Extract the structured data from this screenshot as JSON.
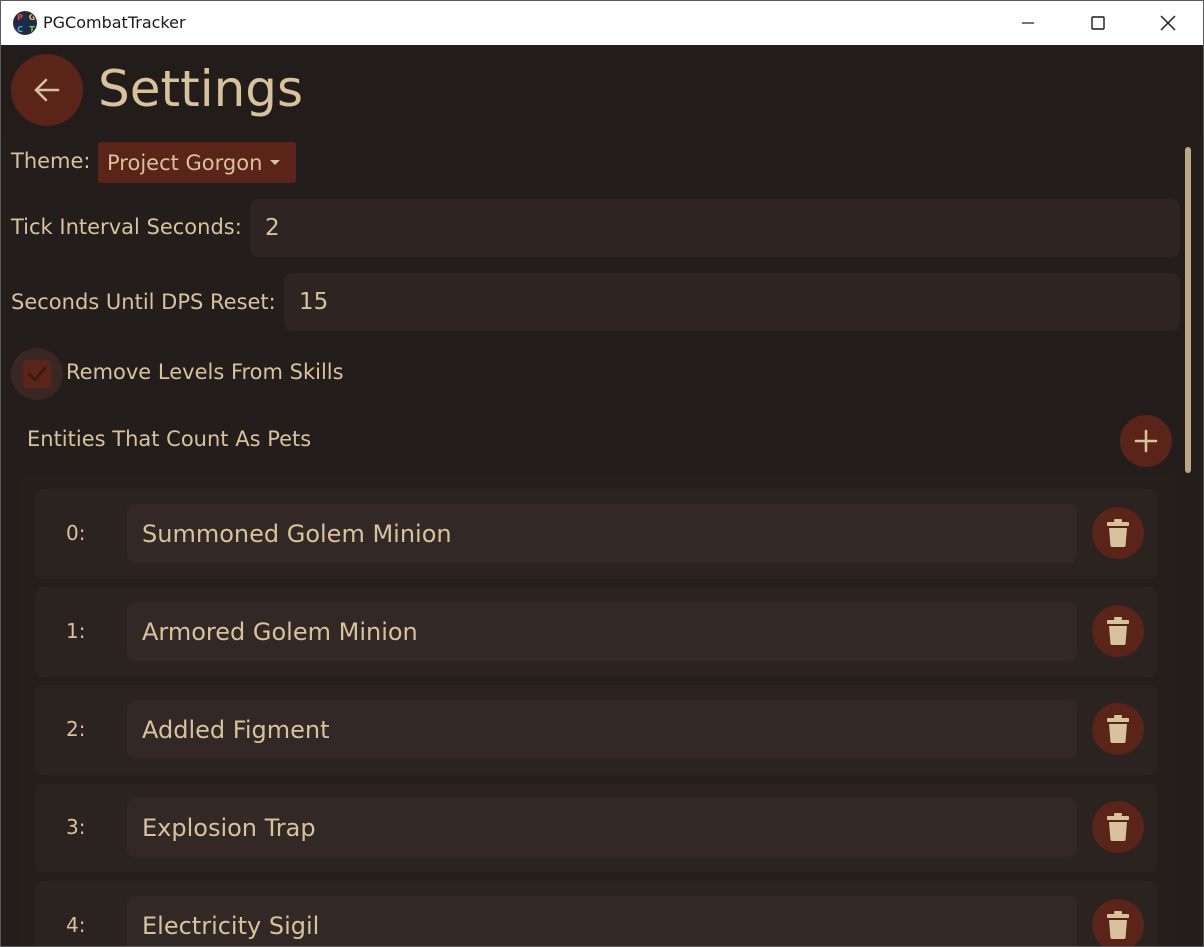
{
  "window": {
    "title": "PGCombatTracker",
    "logo_letters": [
      "P",
      "G",
      "C",
      "T"
    ]
  },
  "header": {
    "title": "Settings"
  },
  "settings": {
    "theme_label": "Theme:",
    "theme_value": "Project Gorgon",
    "tick_label": "Tick Interval Seconds:",
    "tick_value": "2",
    "dps_label": "Seconds Until DPS Reset:",
    "dps_value": "15",
    "remove_levels_label": "Remove Levels From Skills",
    "remove_levels_checked": true,
    "pets_label": "Entities That Count As Pets"
  },
  "pets": [
    {
      "index": "0:",
      "name": "Summoned Golem Minion"
    },
    {
      "index": "1:",
      "name": "Armored Golem Minion"
    },
    {
      "index": "2:",
      "name": "Addled Figment"
    },
    {
      "index": "3:",
      "name": "Explosion Trap"
    },
    {
      "index": "4:",
      "name": "Electricity Sigil"
    }
  ],
  "colors": {
    "background": "#231e1b",
    "accent": "#5a2419",
    "text": "#d8c29b",
    "input": "#2e2522"
  }
}
